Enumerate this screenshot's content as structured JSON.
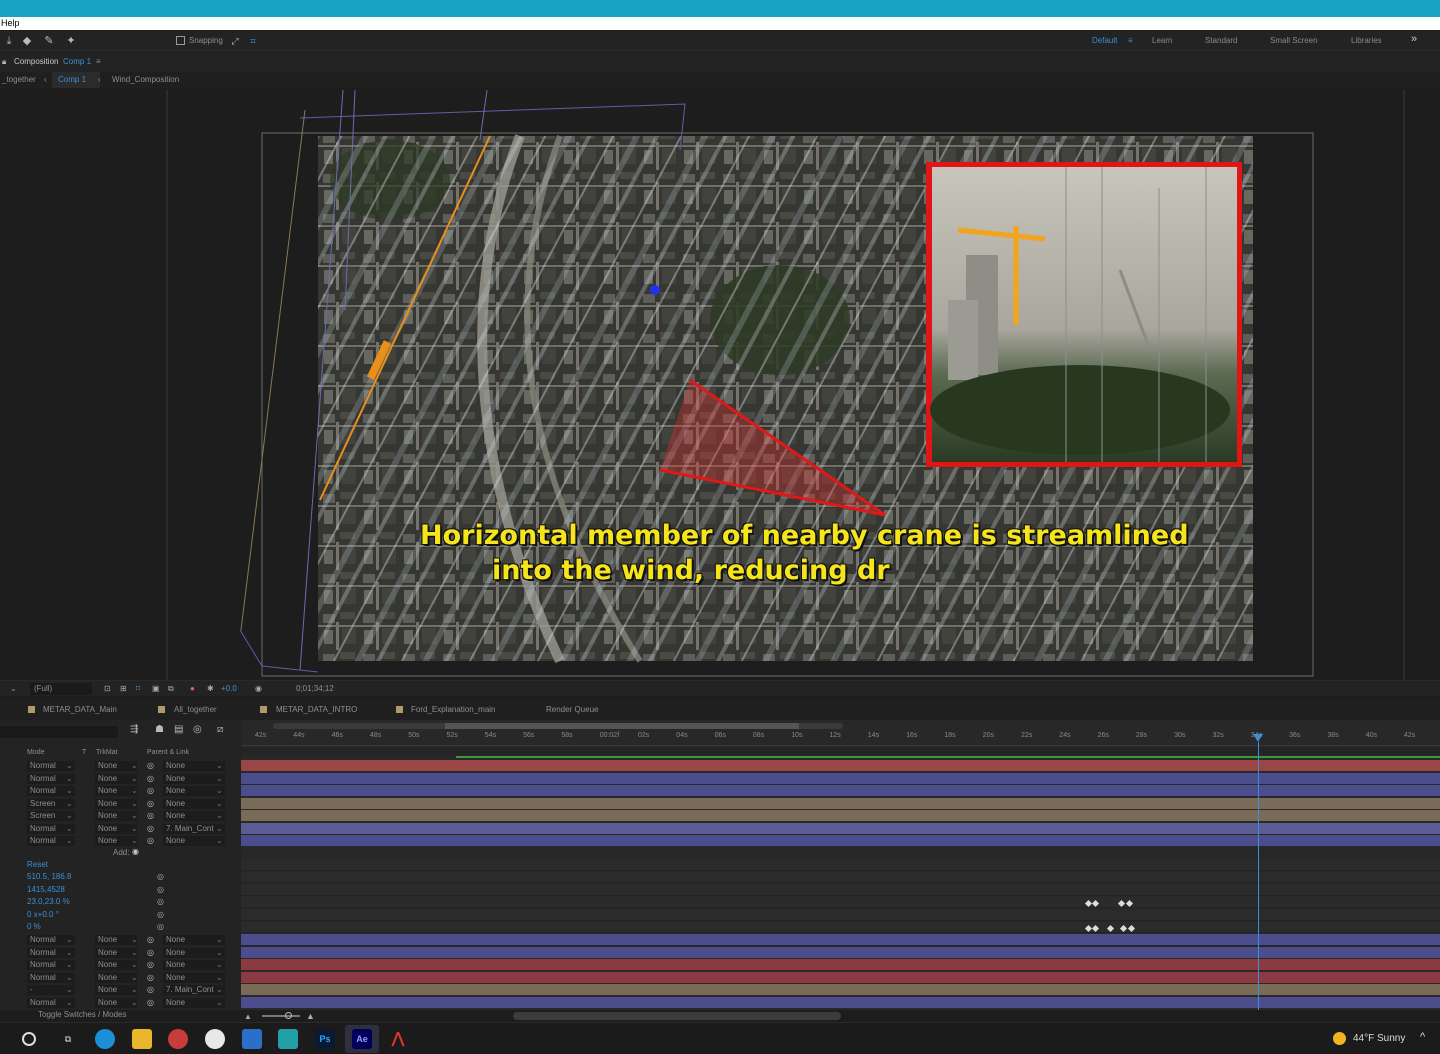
{
  "menubar": {
    "help": "Help"
  },
  "toolbar": {
    "snapping": "Snapping",
    "workspaces": [
      "Default",
      "Learn",
      "Standard",
      "Small Screen",
      "Libraries"
    ],
    "more": "»"
  },
  "comp_header": {
    "label": "Composition",
    "comp_name": "Comp 1",
    "menu_icon": "≡"
  },
  "breadcrumbs": [
    "_together",
    "Comp 1",
    "Wind_Composition"
  ],
  "caption": {
    "line1": "Horizontal member of nearby crane is streamlined",
    "line2": "into the wind, reducing dr"
  },
  "viewer_controls": {
    "resolution": "(Full)",
    "exposure": "+0.0",
    "timecode": "0;01;34;12"
  },
  "timeline_tabs": [
    "METAR_DATA_Main",
    "All_together",
    "METAR_DATA_INTRO",
    "Ford_Explanation_main",
    "Render Queue"
  ],
  "columns": {
    "mode": "Mode",
    "t": "T",
    "trkmat": "TrkMat",
    "parent": "Parent & Link"
  },
  "ruler": [
    "42s",
    "44s",
    "46s",
    "48s",
    "50s",
    "52s",
    "54s",
    "56s",
    "58s",
    "00:02f",
    "02s",
    "04s",
    "06s",
    "08s",
    "10s",
    "12s",
    "14s",
    "16s",
    "18s",
    "20s",
    "22s",
    "24s",
    "26s",
    "28s",
    "30s",
    "32s",
    "34s",
    "36s",
    "38s",
    "40s",
    "42s"
  ],
  "layers_top": [
    {
      "mode": "Normal",
      "trkmat": "None",
      "parent": "None",
      "color": "#9a4646"
    },
    {
      "mode": "Normal",
      "trkmat": "None",
      "parent": "None",
      "color": "#4b4d8c"
    },
    {
      "mode": "Normal",
      "trkmat": "None",
      "parent": "None",
      "color": "#4b4d8c"
    },
    {
      "mode": "Screen",
      "trkmat": "None",
      "parent": "None",
      "color": "#7a6a58"
    },
    {
      "mode": "Screen",
      "trkmat": "None",
      "parent": "None",
      "color": "#7a6a58"
    },
    {
      "mode": "Normal",
      "trkmat": "None",
      "parent": "7. Main_Cont",
      "color": "#5a5c94"
    },
    {
      "mode": "Normal",
      "trkmat": "None",
      "parent": "None",
      "color": "#4b4d8c"
    }
  ],
  "add_label": "Add:",
  "properties": [
    {
      "value": "Reset"
    },
    {
      "value": "510.5, 186.8"
    },
    {
      "value": "1415,4528"
    },
    {
      "value": "23.0,23.0 %"
    },
    {
      "value": "0 x+0.0 °"
    },
    {
      "value": "0 %"
    }
  ],
  "layers_bottom": [
    {
      "mode": "Normal",
      "trkmat": "None",
      "parent": "None",
      "color": "#4b4d8c"
    },
    {
      "mode": "Normal",
      "trkmat": "None",
      "parent": "None",
      "color": "#4b4d8c"
    },
    {
      "mode": "Normal",
      "trkmat": "None",
      "parent": "None",
      "color": "#8a3a40"
    },
    {
      "mode": "Normal",
      "trkmat": "None",
      "parent": "None",
      "color": "#8a3a40"
    },
    {
      "mode": "-",
      "trkmat": "None",
      "parent": "7. Main_Cont",
      "color": "#7a6a58"
    },
    {
      "mode": "Normal",
      "trkmat": "None",
      "parent": "None",
      "color": "#4b4d8c"
    }
  ],
  "footer": {
    "toggle": "Toggle Switches / Modes"
  },
  "taskbar": {
    "icons": [
      "search-icon",
      "task-view-icon",
      "edge-icon",
      "explorer-icon",
      "app-icon",
      "slack-icon",
      "mail-icon",
      "app-icon-2",
      "Ps",
      "Ae",
      "acrobat-icon"
    ],
    "ps": "Ps",
    "ae": "Ae",
    "weather": "44°F  Sunny",
    "tray": "^"
  }
}
